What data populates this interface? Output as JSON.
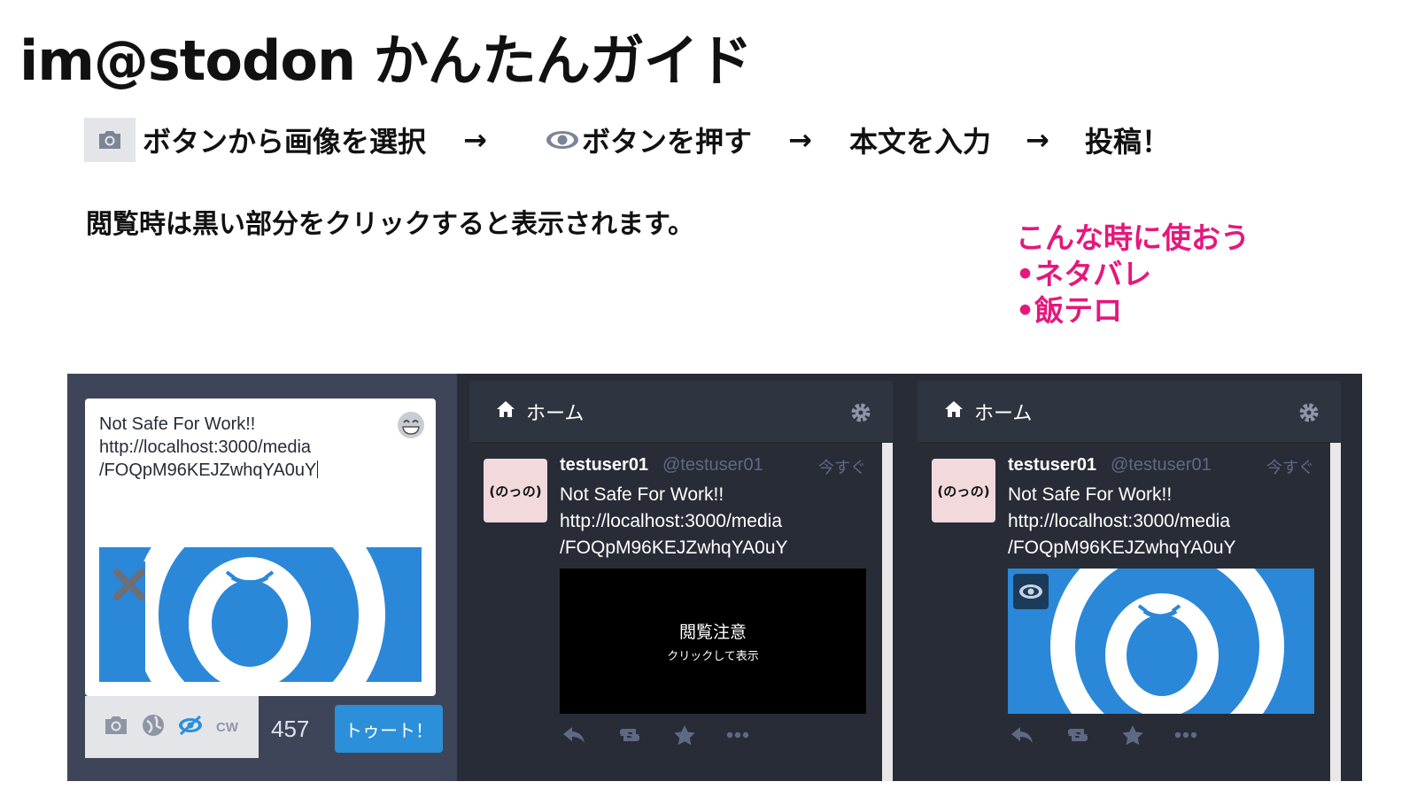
{
  "title": "im@stodon かんたんガイド",
  "steps": {
    "select": "ボタンから画像を選択",
    "arrow": "→",
    "press": "ボタンを押す",
    "body": "本文を入力",
    "post": "投稿！"
  },
  "note": "閲覧時は黒い部分をクリックすると表示されます。",
  "callout": {
    "heading": "こんな時に使おう",
    "items": [
      "•ネタバレ",
      "•飯テロ"
    ]
  },
  "compose": {
    "text": "Not Safe For Work!!\nhttp://localhost:3000/media\n/FOQpM96KEJZwhqYA0uY",
    "cw_label": "CW",
    "char_count": "457",
    "toot_label": "トゥート！"
  },
  "columns": [
    {
      "title": "ホーム"
    },
    {
      "title": "ホーム"
    }
  ],
  "status": {
    "display_name": "testuser01",
    "handle": "@testuser01",
    "time": "今すぐ",
    "avatar_text": "(のっの)",
    "body": "Not Safe For Work!!\nhttp://localhost:3000/media\n/FOQpM96KEJZwhqYA0uY"
  },
  "sensitive": {
    "warning": "閲覧注意",
    "hint": "クリックして表示"
  },
  "colors": {
    "accent": "#2b90d9",
    "callout": "#e5177c",
    "panel": "#282c37",
    "compose_bg": "#3e4558"
  }
}
